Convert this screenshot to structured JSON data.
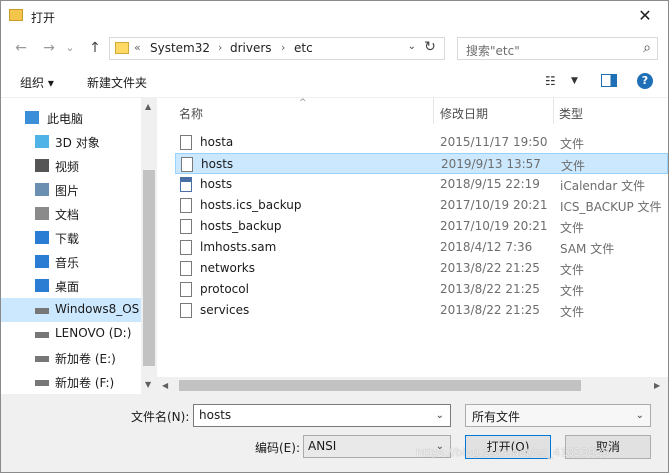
{
  "window": {
    "title": "打开",
    "close_glyph": "✕"
  },
  "nav": {
    "back_glyph": "←",
    "forward_glyph": "→",
    "recent_glyph": "⌄",
    "up_glyph": "↑",
    "address": {
      "prefix": "«",
      "crumbs": [
        "System32",
        "drivers",
        "etc"
      ],
      "sep": "›",
      "dropdown": "⌄",
      "refresh_glyph": "↻"
    },
    "search": {
      "placeholder": "搜索\"etc\"",
      "icon_glyph": "⌕"
    }
  },
  "toolbar": {
    "organize": "组织 ▾",
    "new_folder": "新建文件夹",
    "view_glyph": "☷",
    "view_dd": "▼",
    "help": "?"
  },
  "sidebar": {
    "items": [
      {
        "label": "此电脑",
        "icon": "pc-icon"
      },
      {
        "label": "3D 对象",
        "icon": "cube-icon"
      },
      {
        "label": "视频",
        "icon": "video-icon"
      },
      {
        "label": "图片",
        "icon": "picture-icon"
      },
      {
        "label": "文档",
        "icon": "document-icon"
      },
      {
        "label": "下载",
        "icon": "download-icon"
      },
      {
        "label": "音乐",
        "icon": "music-icon"
      },
      {
        "label": "桌面",
        "icon": "desktop-icon"
      },
      {
        "label": "Windows8_OS",
        "icon": "drive-icon"
      },
      {
        "label": "LENOVO (D:)",
        "icon": "drive-icon"
      },
      {
        "label": "新加卷 (E:)",
        "icon": "drive-icon"
      },
      {
        "label": "新加卷 (F:)",
        "icon": "drive-icon"
      }
    ],
    "selected_index": 8,
    "scroll_up": "▲",
    "scroll_down": "▼"
  },
  "filelist": {
    "columns": {
      "name": "名称",
      "date": "修改日期",
      "type": "类型",
      "sort_caret": "^"
    },
    "rows": [
      {
        "name": "hosta",
        "date": "2015/11/17 19:50",
        "type": "文件",
        "icon": "file-icon"
      },
      {
        "name": "hosts",
        "date": "2019/9/13 13:57",
        "type": "文件",
        "icon": "file-icon"
      },
      {
        "name": "hosts",
        "date": "2018/9/15 22:19",
        "type": "iCalendar 文件",
        "icon": "calendar-file-icon"
      },
      {
        "name": "hosts.ics_backup",
        "date": "2017/10/19 20:21",
        "type": "ICS_BACKUP 文件",
        "icon": "file-icon"
      },
      {
        "name": "hosts_backup",
        "date": "2017/10/19 20:21",
        "type": "文件",
        "icon": "file-icon"
      },
      {
        "name": "lmhosts.sam",
        "date": "2018/4/12 7:36",
        "type": "SAM 文件",
        "icon": "file-icon"
      },
      {
        "name": "networks",
        "date": "2013/8/22 21:25",
        "type": "文件",
        "icon": "file-icon"
      },
      {
        "name": "protocol",
        "date": "2013/8/22 21:25",
        "type": "文件",
        "icon": "file-icon"
      },
      {
        "name": "services",
        "date": "2013/8/22 21:25",
        "type": "文件",
        "icon": "file-icon"
      }
    ],
    "selected_index": 1,
    "hscroll_left": "◀",
    "hscroll_right": "▶"
  },
  "bottom": {
    "filename_label": "文件名(N):",
    "filename_value": "hosts",
    "filetype_value": "所有文件",
    "encoding_label": "编码(E):",
    "encoding_value": "ANSI",
    "open_label": "打开(O)",
    "cancel_label": "取消",
    "dd_glyph": "⌄"
  },
  "watermark": "https://blog.csdn.net/qq_41823935"
}
